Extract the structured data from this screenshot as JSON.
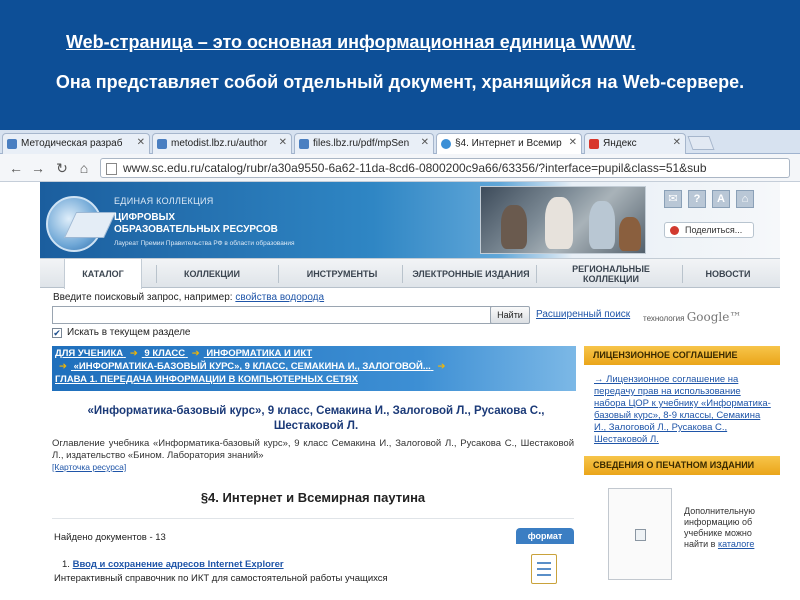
{
  "slide": {
    "line1": "Web-страница – это основная информационная единица WWW.",
    "line2": "Она представляет собой отдельный документ, хранящийся на Web-сервере."
  },
  "browser": {
    "tabs": [
      {
        "title": "Методическая разраб",
        "icon": "doc-icon",
        "active": false
      },
      {
        "title": "metodist.lbz.ru/author",
        "icon": "doc-icon",
        "active": false
      },
      {
        "title": "files.lbz.ru/pdf/mpSen",
        "icon": "doc-icon",
        "active": false
      },
      {
        "title": "§4. Интернет и Всемир",
        "icon": "globe-icon",
        "active": true
      },
      {
        "title": "Яндекс",
        "icon": "yandex-icon",
        "active": false
      }
    ],
    "url": "www.sc.edu.ru/catalog/rubr/a30a9550-6a62-11da-8cd6-0800200c9a66/63356/?interface=pupil&class=51&sub"
  },
  "site": {
    "brand_line1": "ЕДИНАЯ КОЛЛЕКЦИЯ",
    "brand_line2a": "ЦИФРОВЫХ",
    "brand_line2b": "ОБРАЗОВАТЕЛЬНЫХ РЕСУРСОВ",
    "brand_line3": "Лауреат Премии Правительства РФ в области образования",
    "header_icons": [
      "mail-icon",
      "help-icon",
      "font-size-icon",
      "home-icon"
    ],
    "header_icon_glyphs": [
      "✉",
      "?",
      "A",
      "⌂"
    ],
    "share_label": "Поделиться...",
    "menu": [
      {
        "label": "КАТАЛОГ",
        "active": true
      },
      {
        "label": "КОЛЛЕКЦИИ",
        "active": false
      },
      {
        "label": "ИНСТРУМЕНТЫ",
        "active": false
      },
      {
        "label": "ЭЛЕКТРОННЫЕ ИЗДАНИЯ",
        "active": false
      },
      {
        "label": "РЕГИОНАЛЬНЫЕ КОЛЛЕКЦИИ",
        "active": false
      },
      {
        "label": "НОВОСТИ",
        "active": false
      }
    ]
  },
  "search": {
    "hint": "Введите поисковый запрос, например:",
    "hint_example": "свойства водорода",
    "query": "",
    "find_button": "Найти",
    "advanced_link": "Расширенный поиск",
    "tech_label": "технология",
    "tech_brand": "Google™",
    "in_section_label": "Искать в текущем разделе",
    "in_section_checked": true
  },
  "breadcrumbs": {
    "line1": [
      "ДЛЯ УЧЕНИКА",
      "9 КЛАСС",
      "ИНФОРМАТИКА И ИКТ"
    ],
    "line2": "«ИНФОРМАТИКА-БАЗОВЫЙ КУРС», 9 КЛАСС, СЕМАКИНА И., ЗАЛОГОВОЙ...",
    "line3": "ГЛАВА 1. ПЕРЕДАЧА ИНФОРМАЦИИ В КОМПЬЮТЕРНЫХ СЕТЯХ"
  },
  "content": {
    "book_title": "«Информатика-базовый курс», 9 класс, Семакина И., Залоговой Л., Русакова С., Шестаковой Л.",
    "toc_text": "Оглавление учебника «Информатика-базовый курс», 9 класс Семакина И., Залоговой Л., Русакова С., Шестаковой Л., издательство «Бином. Лаборатория знаний»",
    "card_link": "[Карточка ресурса]",
    "section_title": "§4. Интернет и Всемирная паутина",
    "found": "Найдено документов - 13",
    "format_label": "формат",
    "doc_number": "1.",
    "doc_link": "Ввод и сохранение адресов Internet Explorer",
    "doc_desc": "Интерактивный справочник по ИКТ для самостоятельной работы учащихся"
  },
  "sidebar": {
    "license_heading": "ЛИЦЕНЗИОННОЕ СОГЛАШЕНИЕ",
    "license_link": "Лицензионное соглашение на передачу прав на использование набора ЦОР к учебнику «Информатика-базовый курс», 8-9 классы, Семакина И., Залоговой Л., Русакова С., Шестаковой Л.",
    "print_heading": "СВЕДЕНИЯ О ПЕЧАТНОМ ИЗДАНИИ",
    "print_note": "Дополнительную информацию об учебнике можно найти в",
    "print_note_link": "каталоге"
  },
  "colors": {
    "slide_bg": "#0d4f97",
    "link": "#1f55a8",
    "accent_orange": "#eaa51a",
    "crumb_blue": "#1f6fbc"
  }
}
